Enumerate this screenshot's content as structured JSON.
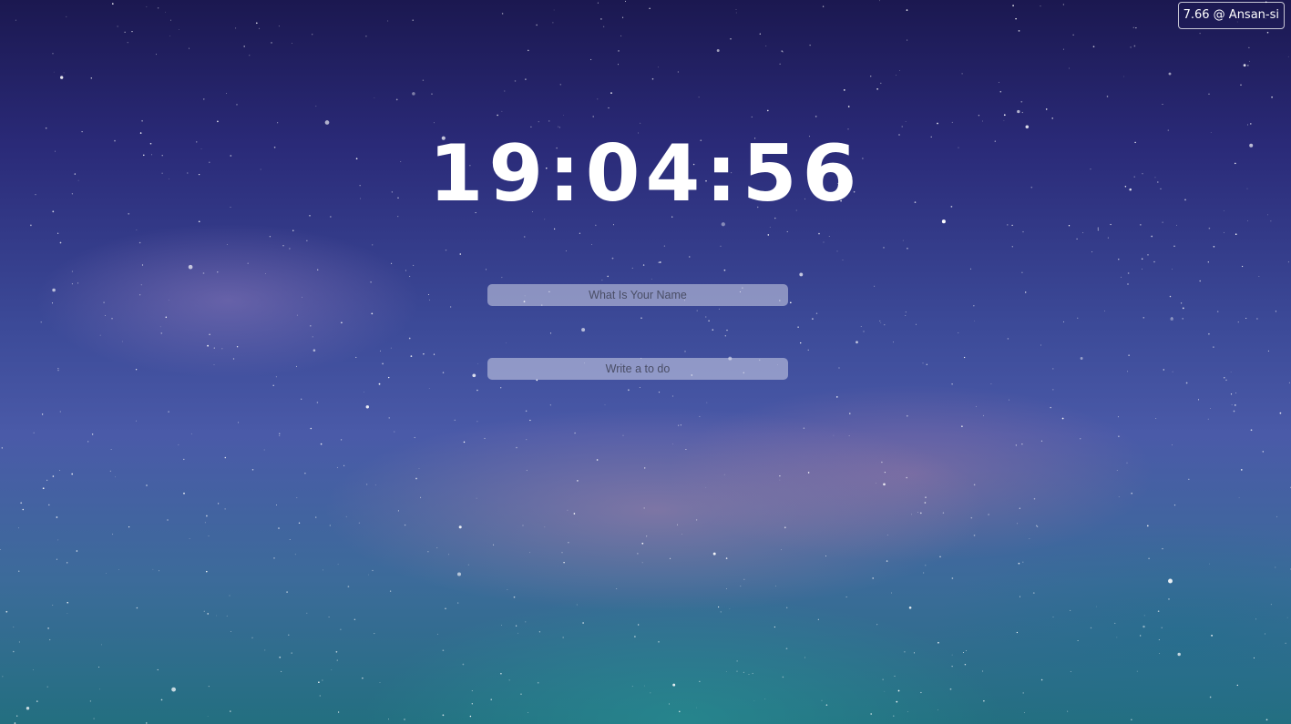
{
  "clock": {
    "time": "19:04:56"
  },
  "name_input": {
    "placeholder": "What Is Your Name",
    "value": ""
  },
  "todo_input": {
    "placeholder": "Write a to do",
    "value": ""
  },
  "weather": {
    "text": "7.66 @ Ansan-si"
  },
  "colors": {
    "text": "#ffffff",
    "input_background": "rgba(230,232,245,0.48)"
  }
}
